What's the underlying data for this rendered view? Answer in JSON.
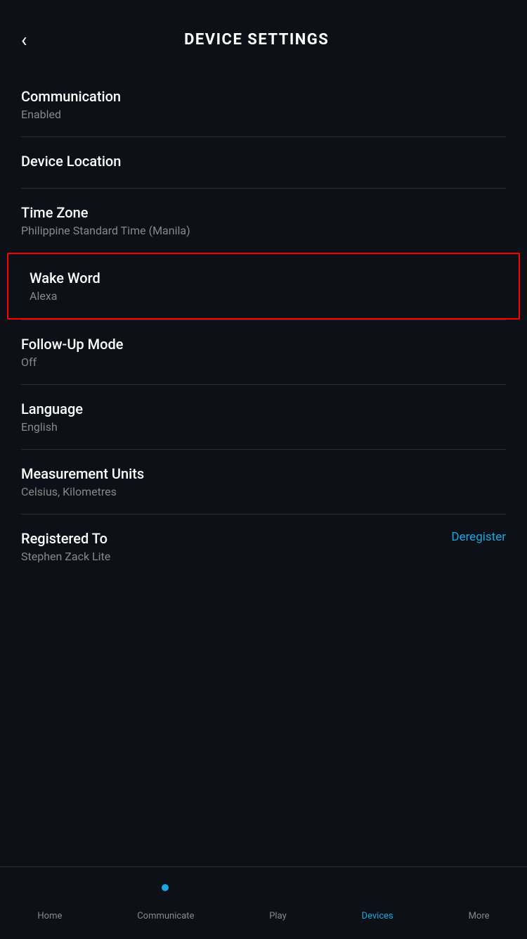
{
  "header": {
    "back_label": "‹",
    "title": "DEVICE SETTINGS"
  },
  "settings": [
    {
      "id": "communication",
      "label": "Communication",
      "value": "Enabled",
      "highlighted": false
    },
    {
      "id": "device-location",
      "label": "Device Location",
      "value": "",
      "highlighted": false
    },
    {
      "id": "time-zone",
      "label": "Time Zone",
      "value": "Philippine Standard Time (Manila)",
      "highlighted": false
    },
    {
      "id": "wake-word",
      "label": "Wake Word",
      "value": "Alexa",
      "highlighted": true
    },
    {
      "id": "follow-up-mode",
      "label": "Follow-Up Mode",
      "value": "Off",
      "highlighted": false
    },
    {
      "id": "language",
      "label": "Language",
      "value": "English",
      "highlighted": false
    },
    {
      "id": "measurement-units",
      "label": "Measurement Units",
      "value": "Celsius, Kilometres",
      "highlighted": false
    }
  ],
  "registered": {
    "label": "Registered To",
    "value": "Stephen Zack Lite",
    "deregister_label": "Deregister"
  },
  "bottom_nav": {
    "items": [
      {
        "id": "home",
        "label": "Home",
        "active": false
      },
      {
        "id": "communicate",
        "label": "Communicate",
        "active": false,
        "has_dot": true
      },
      {
        "id": "play",
        "label": "Play",
        "active": false
      },
      {
        "id": "devices",
        "label": "Devices",
        "active": true
      },
      {
        "id": "more",
        "label": "More",
        "active": false
      }
    ]
  }
}
